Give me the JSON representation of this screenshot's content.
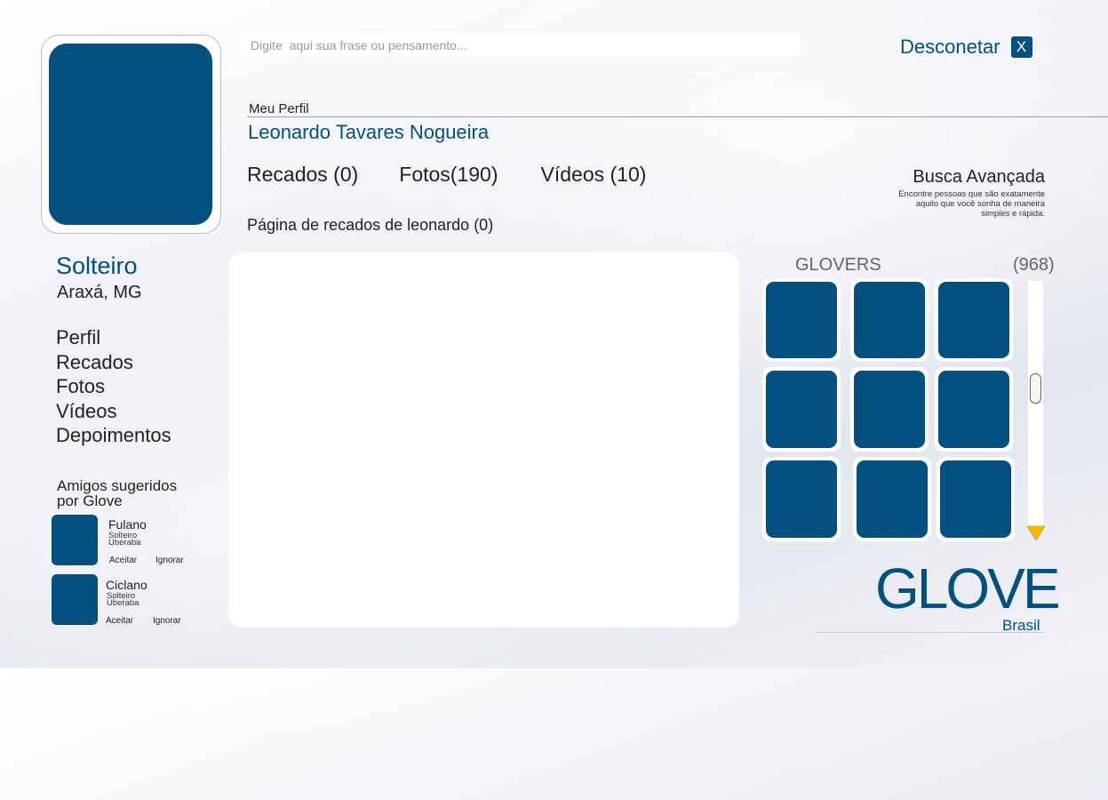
{
  "status_input": {
    "placeholder": "Digite  aqui sua frase ou pensamento..."
  },
  "header": {
    "logout_label": "Desconetar",
    "logout_icon": "X"
  },
  "profile": {
    "section_label": "Meu Perfil",
    "name": "Leonardo Tavares Nogueira",
    "relationship": "Solteiro",
    "location": "Araxá, MG"
  },
  "counts": {
    "recados": "Recados (0)",
    "fotos": "Fotos(190)",
    "videos": "Vídeos (10)"
  },
  "busca": {
    "title": "Busca Avançada",
    "line1": "Encontre pessoas que são exatamente",
    "line2": "aquilo que você sonha de maneira",
    "line3": "simples e rápida."
  },
  "recados_page_title": "Página de recados de leonardo (0)",
  "nav": [
    "Perfil",
    "Recados",
    "Fotos",
    "Vídeos",
    "Depoimentos"
  ],
  "suggestions": {
    "title_line1": "Amigos sugeridos",
    "title_line2": "por  Glove",
    "items": [
      {
        "name": "Fulano",
        "status": "Solteiro",
        "city": "Uberaba",
        "accept": "Aceitar",
        "ignore": "Ignorar"
      },
      {
        "name": "Ciclano",
        "status": "Solteiro",
        "city": "Uberaba",
        "accept": "Aceitar",
        "ignore": "Ignorar"
      }
    ]
  },
  "glovers": {
    "title": "GLOVERS",
    "count": "(968)"
  },
  "logo": {
    "text": "GLOVE",
    "sub": "Brasil"
  },
  "colors": {
    "brand": "#02507f",
    "accent_arrow": "#f2b705"
  }
}
